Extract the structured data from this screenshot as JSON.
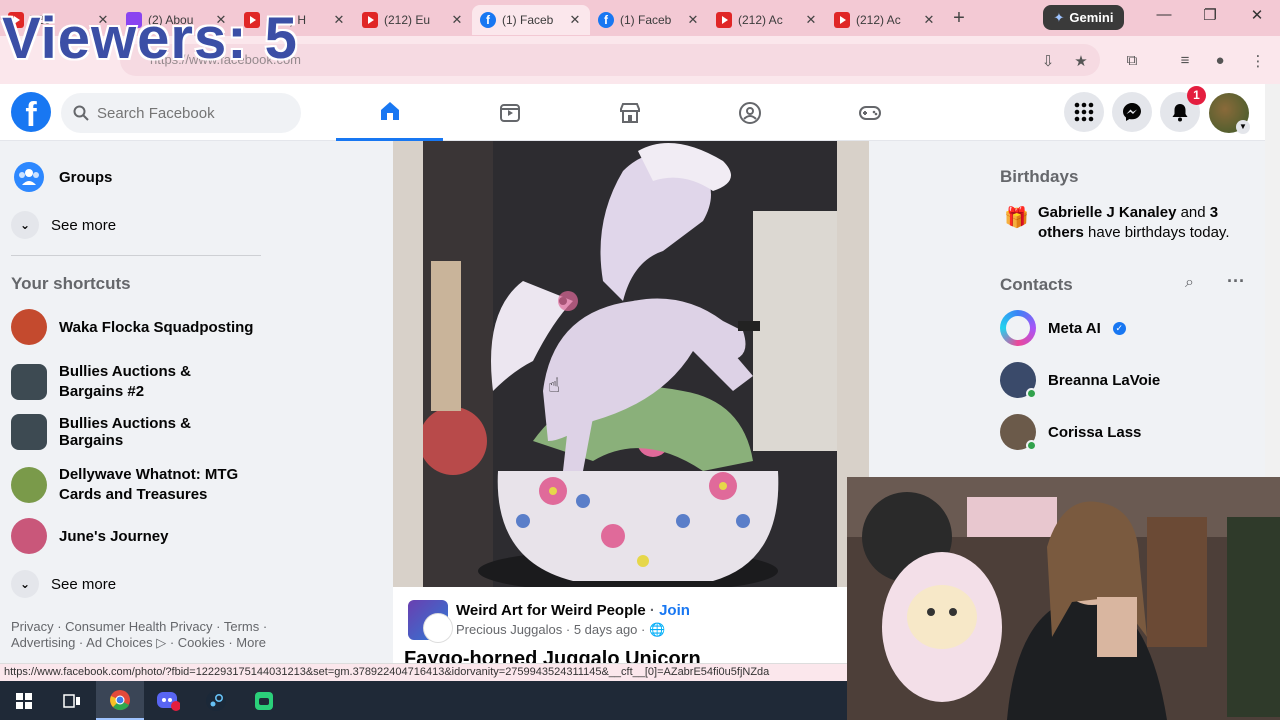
{
  "overlay": {
    "viewers_text": "Viewers: 5"
  },
  "browser": {
    "tabs": [
      {
        "icon": "youtube",
        "title": ") 28"
      },
      {
        "icon": "twitch",
        "title": "(2) Abou"
      },
      {
        "icon": "youtube",
        "title": "(212) H"
      },
      {
        "icon": "youtube",
        "title": "(212) Eu"
      },
      {
        "icon": "facebook",
        "title": "(1) Faceb",
        "active": true
      },
      {
        "icon": "facebook",
        "title": "(1) Faceb"
      },
      {
        "icon": "youtube",
        "title": "(212) Ac"
      },
      {
        "icon": "youtube",
        "title": "(212) Ac"
      }
    ],
    "new_tab_label": "+",
    "gemini_label": "Gemini",
    "url": "https://www.facebook.com",
    "status_url": "https://www.facebook.com/photo/?fbid=122293175144031213&set=gm.378922404716413&idorvanity=2759943524311145&__cft__[0]=AZabrE54fi0u5fjNZda"
  },
  "facebook": {
    "search_placeholder": "Search Facebook",
    "notification_count": "1",
    "left": {
      "groups_label": "Groups",
      "see_more_top": "See more",
      "shortcuts_title": "Your shortcuts",
      "shortcuts": [
        {
          "label": "Waka Flocka Squadposting",
          "color": "#c44a2e"
        },
        {
          "label": "Bullies Auctions & Bargains #2",
          "color": "#3d4a52"
        },
        {
          "label": "Bullies Auctions & Bargains",
          "color": "#3d4a52"
        },
        {
          "label": "Dellywave Whatnot: MTG Cards and Treasures",
          "color": "#7a9a4a"
        },
        {
          "label": "June's Journey",
          "color": "#c9577a"
        }
      ],
      "see_more_bottom": "See more",
      "footer": "Privacy · Consumer Health Privacy · Terms · Advertising · Ad Choices ▷ · Cookies · More"
    },
    "post": {
      "group_name": "Weird Art for Weird People",
      "join_label": "Join",
      "author": "Precious Juggalos",
      "age": "5 days ago",
      "title": "Faygo-horned Juggalo Unicorn"
    },
    "right": {
      "birthdays_title": "Birthdays",
      "birthday_name": "Gabrielle J Kanaley",
      "birthday_and": " and ",
      "birthday_others": "3 others",
      "birthday_rest": " have birthdays today.",
      "contacts_title": "Contacts",
      "contacts": [
        {
          "name": "Meta AI",
          "verified": true
        },
        {
          "name": "Breanna LaVoie",
          "online": true
        },
        {
          "name": "Corissa Lass",
          "online": true
        }
      ]
    }
  }
}
